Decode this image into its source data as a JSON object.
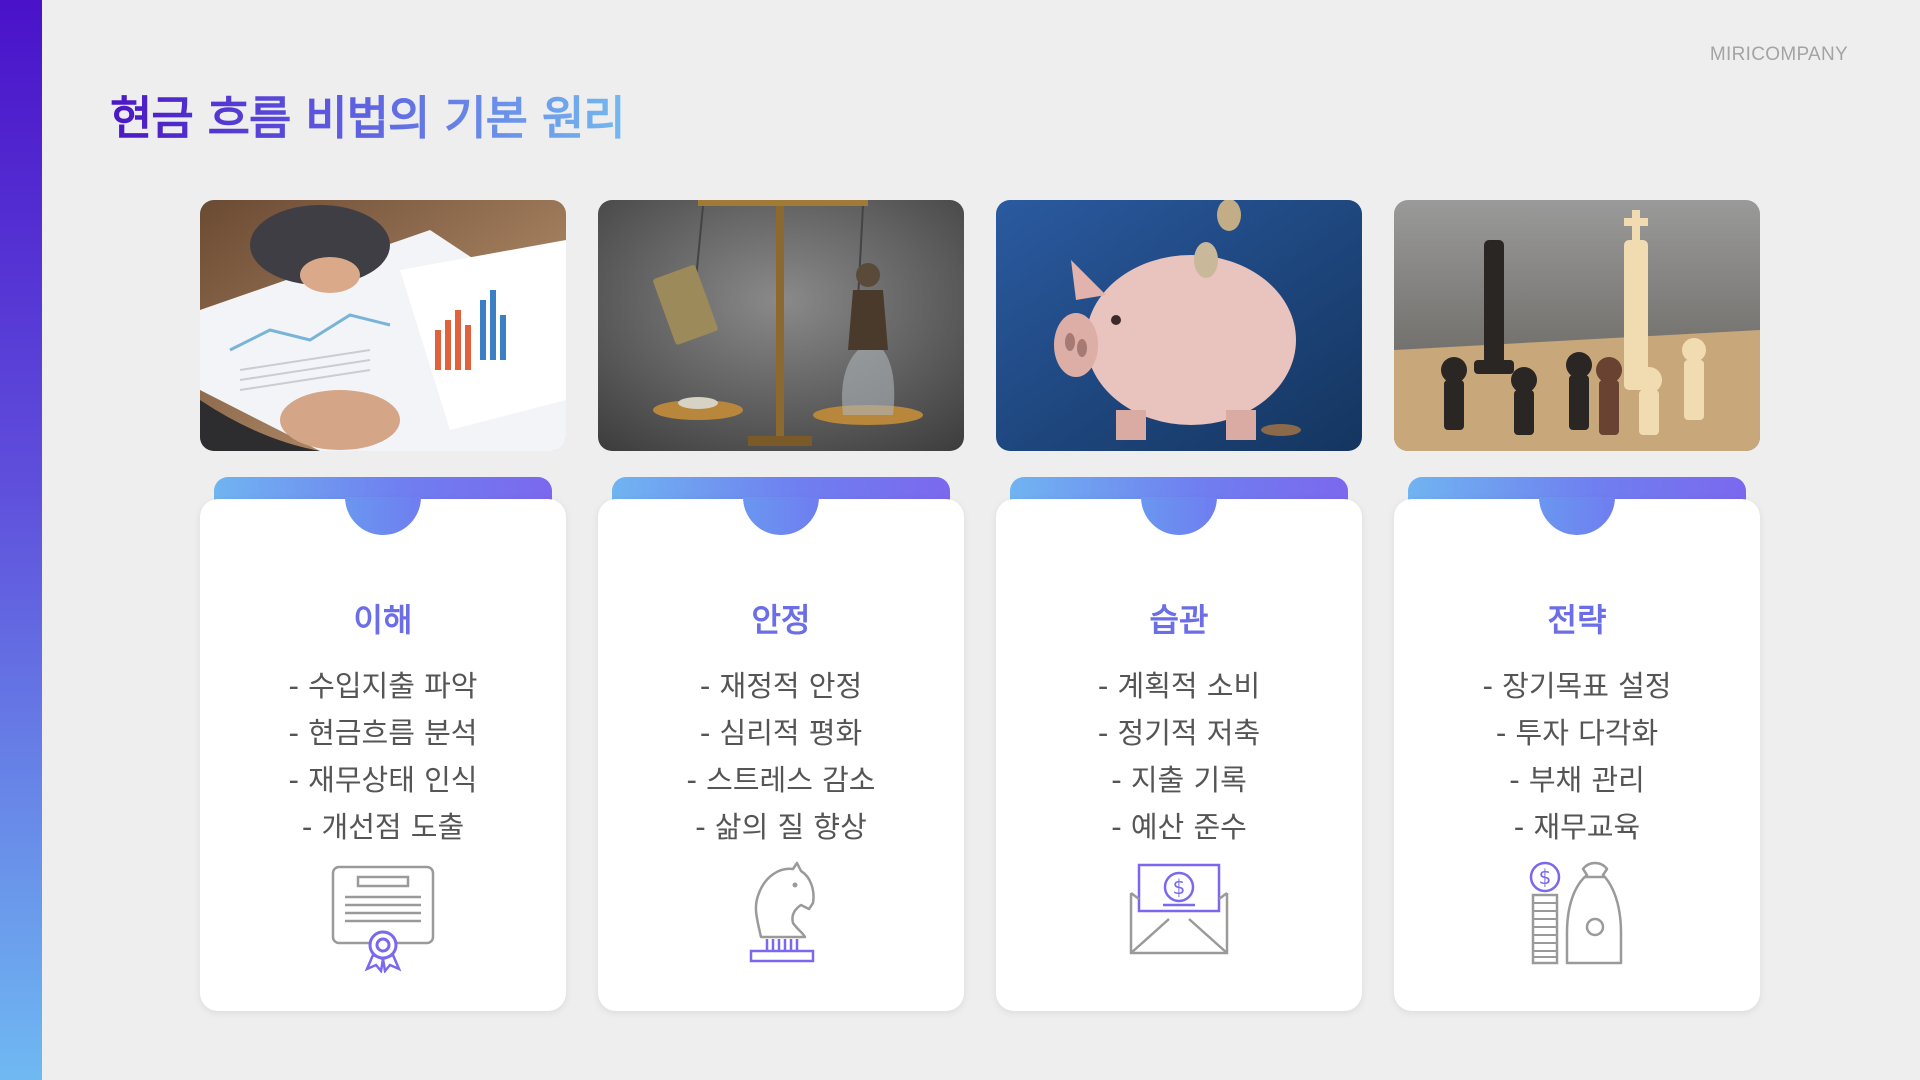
{
  "brand": "MIRICOMPANY",
  "title": "현금 흐름 비법의 기본 원리",
  "cards": [
    {
      "photo": "financial-report-photo",
      "title": "이해",
      "items": [
        "- 수입지출 파악",
        "- 현금흐름 분석",
        "- 재무상태 인식",
        "- 개선점 도출"
      ],
      "icon": "certificate-icon"
    },
    {
      "photo": "balance-scale-photo",
      "title": "안정",
      "items": [
        "- 재정적 안정",
        "- 심리적 평화",
        "- 스트레스 감소",
        "- 삶의 질 향상"
      ],
      "icon": "chess-knight-icon"
    },
    {
      "photo": "piggy-bank-photo",
      "title": "습관",
      "items": [
        "- 계획적 소비",
        "- 정기적 저축",
        "- 지출 기록",
        "- 예산 준수"
      ],
      "icon": "money-envelope-icon"
    },
    {
      "photo": "chess-pieces-photo",
      "title": "전략",
      "items": [
        "- 장기목표 설정",
        "- 투자 다각화",
        "- 부채 관리",
        "- 재무교육"
      ],
      "icon": "coins-money-bag-icon"
    }
  ],
  "colors": {
    "accent": "#6b6ee6",
    "gradient_start": "#4b16c4",
    "gradient_end": "#74b9f0",
    "background": "#eeeeee"
  }
}
